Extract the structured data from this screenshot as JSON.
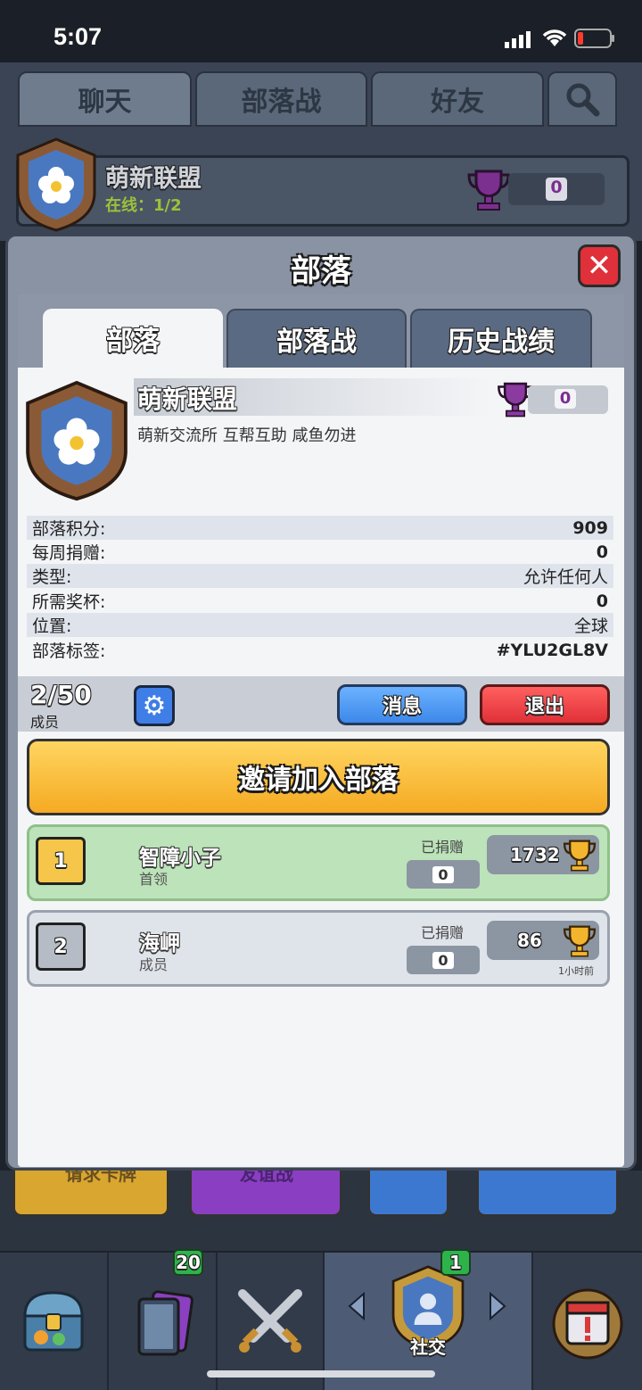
{
  "status_bar": {
    "time": "5:07"
  },
  "top_tabs": [
    "聊天",
    "部落战",
    "好友"
  ],
  "clan_bar": {
    "name": "萌新联盟",
    "online": "在线：1/2",
    "trophies": "0"
  },
  "modal": {
    "title": "部落",
    "close_label": "✕",
    "tabs": [
      "部落",
      "部落战",
      "历史战绩"
    ],
    "clan": {
      "name": "萌新联盟",
      "description": "萌新交流所 互帮互助 咸鱼勿进",
      "trophies": "0"
    },
    "stats": [
      {
        "label": "部落积分:",
        "value": "909"
      },
      {
        "label": "每周捐赠:",
        "value": "0"
      },
      {
        "label": "类型:",
        "value": "允许任何人"
      },
      {
        "label": "所需奖杯:",
        "value": "0"
      },
      {
        "label": "位置:",
        "value": "全球"
      },
      {
        "label": "部落标签:",
        "value": "#YLU2GL8V"
      }
    ],
    "members_count": "2/50",
    "members_label": "成员",
    "message_button": "消息",
    "exit_button": "退出",
    "invite_button": "邀请加入部落",
    "members": [
      {
        "rank": "1",
        "name": "智障小子",
        "role": "首领",
        "donated_label": "已捐赠",
        "donated": "0",
        "trophies": "1732",
        "last_seen": ""
      },
      {
        "rank": "2",
        "name": "海岬",
        "role": "成员",
        "donated_label": "已捐赠",
        "donated": "0",
        "trophies": "86",
        "last_seen": "1小时前"
      }
    ]
  },
  "behind_buttons": [
    "请求卡牌",
    "友谊战"
  ],
  "nav": {
    "items": [
      "shop",
      "cards",
      "battle",
      "social",
      "events"
    ],
    "cards_badge": "20",
    "social_badge": "1",
    "social_label": "社交"
  },
  "colors": {
    "accent_gold": "#f5aa22",
    "exit_red": "#e03038",
    "message_blue": "#3c88ea",
    "leader_green": "#bce3b9",
    "trophy_purple": "#7b2f8f"
  }
}
